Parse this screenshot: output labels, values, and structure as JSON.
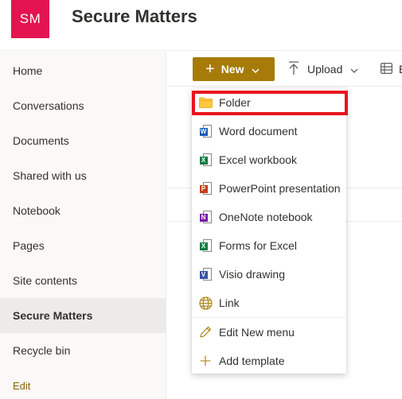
{
  "site": {
    "logo_text": "SM",
    "title": "Secure Matters",
    "logo_color": "#e3144f"
  },
  "sidebar": {
    "items": [
      {
        "label": "Home"
      },
      {
        "label": "Conversations"
      },
      {
        "label": "Documents"
      },
      {
        "label": "Shared with us"
      },
      {
        "label": "Notebook"
      },
      {
        "label": "Pages"
      },
      {
        "label": "Site contents"
      },
      {
        "label": "Secure Matters",
        "selected": true
      },
      {
        "label": "Recycle bin"
      },
      {
        "label": "Edit"
      }
    ]
  },
  "toolbar": {
    "new_label": "New",
    "upload_label": "Upload",
    "edit_grid_label": "E",
    "accent": "#a67b07"
  },
  "new_menu": {
    "items": [
      {
        "label": "Folder",
        "icon": "folder-icon",
        "highlighted": true
      },
      {
        "label": "Word document",
        "icon": "word-icon"
      },
      {
        "label": "Excel workbook",
        "icon": "excel-icon"
      },
      {
        "label": "PowerPoint presentation",
        "icon": "powerpoint-icon"
      },
      {
        "label": "OneNote notebook",
        "icon": "onenote-icon"
      },
      {
        "label": "Forms for Excel",
        "icon": "forms-icon"
      },
      {
        "label": "Visio drawing",
        "icon": "visio-icon"
      },
      {
        "label": "Link",
        "icon": "globe-icon"
      },
      {
        "label": "Edit New menu",
        "icon": "pencil-icon"
      },
      {
        "label": "Add template",
        "icon": "plus-icon"
      }
    ],
    "highlight_color": "#e8141e"
  }
}
